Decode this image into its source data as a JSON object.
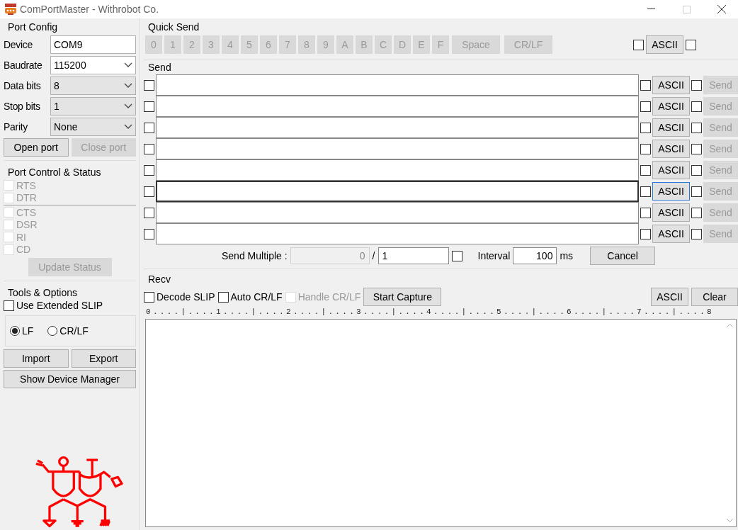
{
  "window": {
    "title": "ComPortMaster - Withrobot Co."
  },
  "port_config": {
    "title": "Port Config",
    "fields": [
      {
        "label": "Device",
        "value": "COM9",
        "kind": "text",
        "disabled": false
      },
      {
        "label": "Baudrate",
        "value": "115200",
        "kind": "select",
        "disabled": false
      },
      {
        "label": "Data bits",
        "value": "8",
        "kind": "select",
        "disabled": true
      },
      {
        "label": "Stop bits",
        "value": "1",
        "kind": "select",
        "disabled": true
      },
      {
        "label": "Parity",
        "value": "None",
        "kind": "select",
        "disabled": true
      }
    ],
    "buttons": [
      {
        "label": "Open port",
        "disabled": false
      },
      {
        "label": "Close port",
        "disabled": true
      }
    ]
  },
  "port_control": {
    "title": "Port Control & Status",
    "outputs": [
      {
        "label": "RTS",
        "checked": false
      },
      {
        "label": "DTR",
        "checked": false
      }
    ],
    "inputs": [
      {
        "label": "CTS",
        "checked": false
      },
      {
        "label": "DSR",
        "checked": false
      },
      {
        "label": "RI",
        "checked": false
      },
      {
        "label": "CD",
        "checked": false
      }
    ],
    "update_button": {
      "label": "Update Status",
      "disabled": true
    }
  },
  "tools": {
    "title": "Tools & Options",
    "extended_slip": {
      "label": "Use Extended SLIP",
      "checked": false
    },
    "line_endings": [
      {
        "label": "LF",
        "selected": true
      },
      {
        "label": "CR/LF",
        "selected": false
      }
    ],
    "buttons": [
      "Import",
      "Export",
      "Show Device Manager"
    ]
  },
  "quick_send": {
    "title": "Quick Send",
    "keys": [
      {
        "label": "0",
        "disabled": true
      },
      {
        "label": "1",
        "disabled": true
      },
      {
        "label": "2",
        "disabled": true
      },
      {
        "label": "3",
        "disabled": true
      },
      {
        "label": "4",
        "disabled": true
      },
      {
        "label": "5",
        "disabled": true
      },
      {
        "label": "6",
        "disabled": true
      },
      {
        "label": "7",
        "disabled": true
      },
      {
        "label": "8",
        "disabled": true
      },
      {
        "label": "9",
        "disabled": true
      },
      {
        "label": "A",
        "disabled": true
      },
      {
        "label": "B",
        "disabled": true
      },
      {
        "label": "C",
        "disabled": true
      },
      {
        "label": "D",
        "disabled": true
      },
      {
        "label": "E",
        "disabled": true
      },
      {
        "label": "F",
        "disabled": true
      },
      {
        "label": "Space",
        "disabled": true
      },
      {
        "label": "CR/LF",
        "disabled": true
      }
    ],
    "left_checked": false,
    "ascii": "ASCII",
    "right_checked": false
  },
  "send": {
    "title": "Send",
    "rows": [
      {
        "checked": false,
        "ascii_checked": false,
        "ascii": "ASCII",
        "send_checked": false,
        "send": "Send",
        "disabled": true,
        "focused": false
      },
      {
        "checked": false,
        "ascii_checked": false,
        "ascii": "ASCII",
        "send_checked": false,
        "send": "Send",
        "disabled": true,
        "focused": false
      },
      {
        "checked": false,
        "ascii_checked": false,
        "ascii": "ASCII",
        "send_checked": false,
        "send": "Send",
        "disabled": true,
        "focused": false
      },
      {
        "checked": false,
        "ascii_checked": false,
        "ascii": "ASCII",
        "send_checked": false,
        "send": "Send",
        "disabled": true,
        "focused": false
      },
      {
        "checked": false,
        "ascii_checked": false,
        "ascii": "ASCII",
        "send_checked": false,
        "send": "Send",
        "disabled": true,
        "focused": false
      },
      {
        "checked": false,
        "ascii_checked": false,
        "ascii": "ASCII",
        "send_checked": false,
        "send": "Send",
        "disabled": true,
        "focused": true
      },
      {
        "checked": false,
        "ascii_checked": false,
        "ascii": "ASCII",
        "send_checked": false,
        "send": "Send",
        "disabled": true,
        "focused": false
      },
      {
        "checked": false,
        "ascii_checked": false,
        "ascii": "ASCII",
        "send_checked": false,
        "send": "Send",
        "disabled": true,
        "focused": false
      }
    ]
  },
  "send_multiple": {
    "label": "Send Multiple :",
    "count": "0",
    "separator": "/",
    "total": "1",
    "checked": false,
    "interval_label": "Interval",
    "interval": "100",
    "unit": "ms",
    "cancel": "Cancel"
  },
  "recv": {
    "title": "Recv",
    "options": [
      {
        "label": "Decode SLIP",
        "checked": false,
        "disabled": false
      },
      {
        "label": "Auto CR/LF",
        "checked": false,
        "disabled": false
      },
      {
        "label": "Handle CR/LF",
        "checked": false,
        "disabled": true
      }
    ],
    "capture": "Start Capture",
    "ascii": "ASCII",
    "clear": "Clear",
    "ruler": "0....|....1....|....2....|....3....|....4....|....5....|....6....|....7....|....8"
  }
}
